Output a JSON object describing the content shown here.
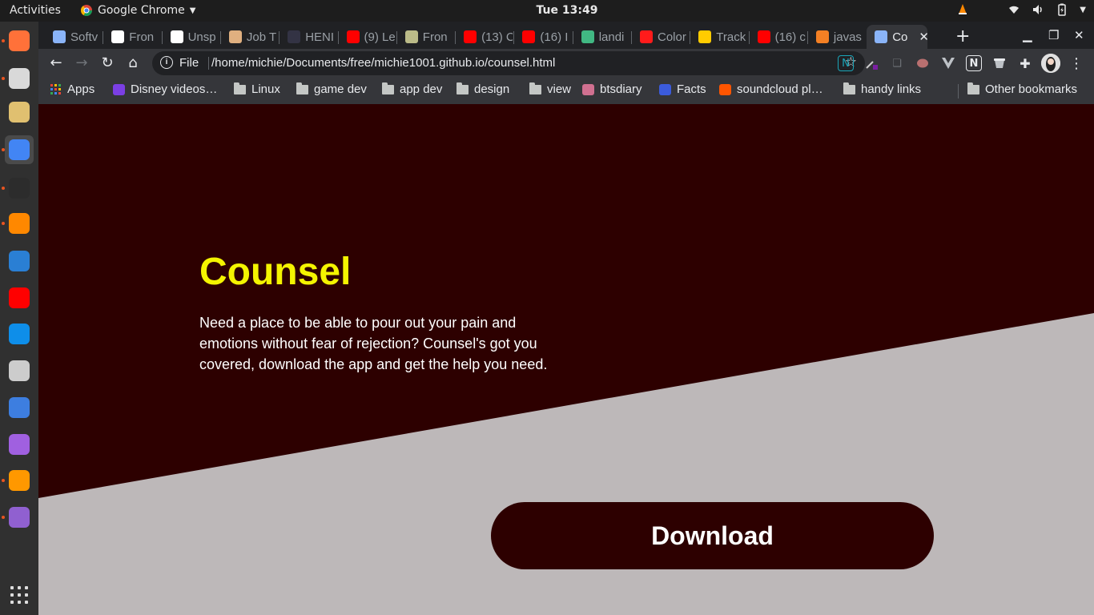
{
  "topbar": {
    "activities": "Activities",
    "app_name": "Google Chrome",
    "clock": "Tue 13:49"
  },
  "dock": {
    "apps": [
      {
        "name": "firefox-icon",
        "color": "#ff7139",
        "running": true
      },
      {
        "name": "files-icon",
        "color": "#d9d9d9",
        "running": true
      },
      {
        "name": "rhythmbox-icon",
        "color": "#e0c070",
        "running": false
      },
      {
        "name": "chrome-icon",
        "color": "#4285f4",
        "running": true,
        "active": true
      },
      {
        "name": "terminal-icon",
        "color": "#2c2c2c",
        "running": true
      },
      {
        "name": "vlc-icon",
        "color": "#ff8800",
        "running": true
      },
      {
        "name": "writer-icon",
        "color": "#2a7fd4",
        "running": false
      },
      {
        "name": "youtube-music-icon",
        "color": "#ff0000",
        "running": false
      },
      {
        "name": "teamviewer-icon",
        "color": "#0e8ee9",
        "running": false
      },
      {
        "name": "inkscape-icon",
        "color": "#cccccc",
        "running": false
      },
      {
        "name": "krita-icon",
        "color": "#3d7ee0",
        "running": false
      },
      {
        "name": "kde-connect-icon",
        "color": "#a060e0",
        "running": false
      },
      {
        "name": "sublime-text-icon",
        "color": "#ff9800",
        "running": true
      },
      {
        "name": "kdenlive-icon",
        "color": "#9060d0",
        "running": true
      }
    ]
  },
  "tabs": [
    {
      "title": "Softv",
      "favicon": "#8ab4f8"
    },
    {
      "title": "Fron",
      "favicon": "#ffffff"
    },
    {
      "title": "Unsp",
      "favicon": "#ffffff"
    },
    {
      "title": "Job T",
      "favicon": "#e0b080"
    },
    {
      "title": "HENI",
      "favicon": "#334"
    },
    {
      "title": "(9) Le",
      "favicon": "#ff0000"
    },
    {
      "title": "Fron",
      "favicon": "#bbbb88"
    },
    {
      "title": "(13) C",
      "favicon": "#ff0000"
    },
    {
      "title": "(16) I",
      "favicon": "#ff0000"
    },
    {
      "title": "landi",
      "favicon": "#41b883"
    },
    {
      "title": "Color",
      "favicon": "#ff1b1b"
    },
    {
      "title": "Track",
      "favicon": "#ffcc00"
    },
    {
      "title": "(16) c",
      "favicon": "#ff0000"
    },
    {
      "title": "javas",
      "favicon": "#f48024"
    },
    {
      "title": "Co",
      "favicon": "#8ab4f8",
      "active": true
    }
  ],
  "toolbar": {
    "scheme": "File",
    "url": "/home/michie/Documents/free/michie1001.github.io/counsel.html"
  },
  "bookmarks": {
    "items": [
      {
        "label": "Apps",
        "type": "apps"
      },
      {
        "label": "Disney videos…",
        "type": "site",
        "color": "#7b3fe4"
      },
      {
        "label": "Linux",
        "type": "folder"
      },
      {
        "label": "game dev",
        "type": "folder"
      },
      {
        "label": "app dev",
        "type": "folder"
      },
      {
        "label": "design",
        "type": "folder"
      },
      {
        "label": "view",
        "type": "folder"
      },
      {
        "label": "btsdiary",
        "type": "site",
        "color": "#d07090"
      },
      {
        "label": "Facts",
        "type": "site",
        "color": "#3b5bdb"
      },
      {
        "label": "soundcloud pl…",
        "type": "site",
        "color": "#ff5500"
      },
      {
        "label": "handy links",
        "type": "folder"
      }
    ],
    "other": "Other bookmarks"
  },
  "page": {
    "title": "Counsel",
    "description": "Need a place to be able to pour out your pain and emotions without fear of rejection? Counsel's got you covered, download the app and get the help you need.",
    "download_label": "Download",
    "colors": {
      "hero_bg": "#2d0000",
      "lower_bg": "#bdb8b9",
      "title": "#f4f400"
    }
  }
}
